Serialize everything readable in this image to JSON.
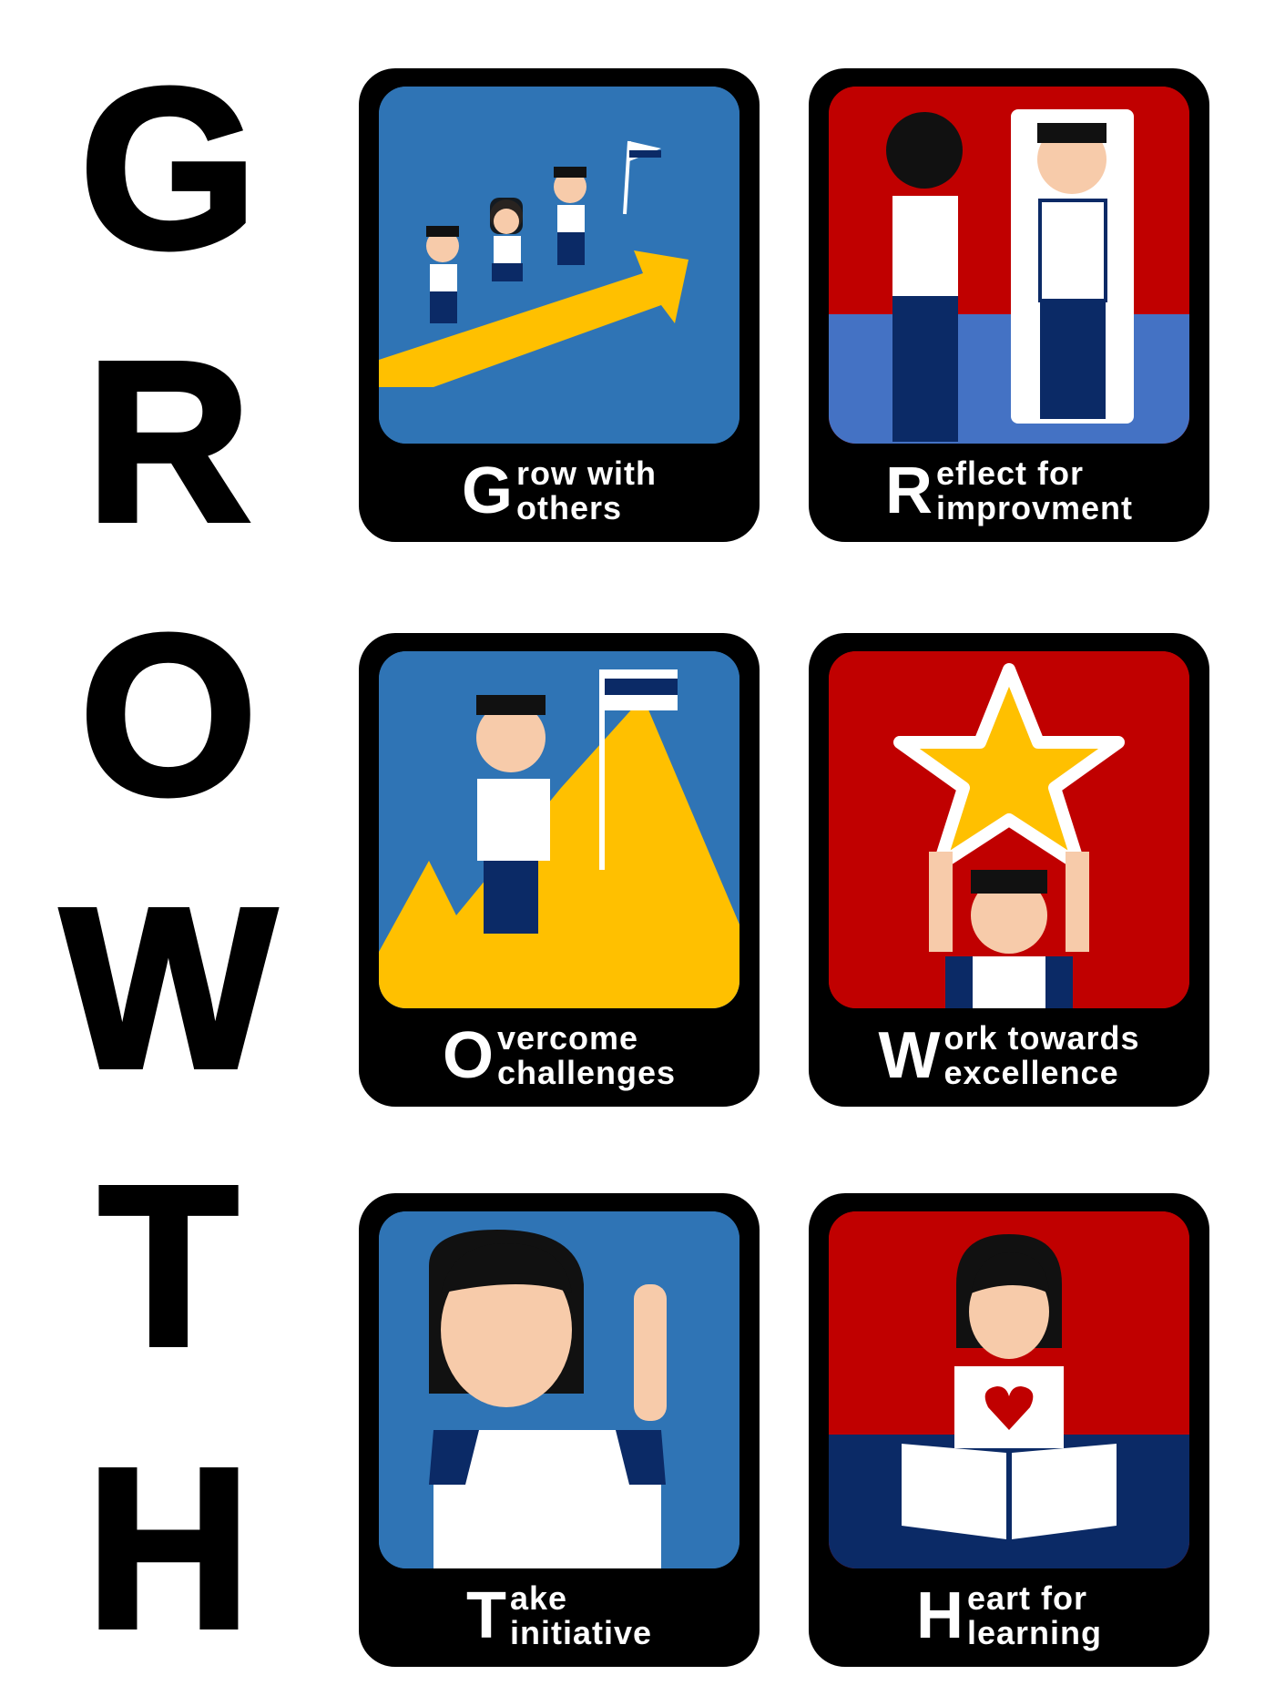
{
  "acronym": [
    "G",
    "R",
    "O",
    "W",
    "T",
    "H"
  ],
  "cards": [
    {
      "initial": "G",
      "line1": "row with",
      "line2": "others",
      "theme": "blue"
    },
    {
      "initial": "R",
      "line1": "eflect for",
      "line2": "improvment",
      "theme": "red"
    },
    {
      "initial": "O",
      "line1": "vercome",
      "line2": "challenges",
      "theme": "blue"
    },
    {
      "initial": "W",
      "line1": "ork towards",
      "line2": "excellence",
      "theme": "red"
    },
    {
      "initial": "T",
      "line1": "ake",
      "line2": "initiative",
      "theme": "blue"
    },
    {
      "initial": "H",
      "line1": "eart for",
      "line2": "learning",
      "theme": "red"
    }
  ],
  "colors": {
    "blue_panel": "#2f74b5",
    "red_panel": "#c00000",
    "navy": "#0b2a66",
    "yellow": "#ffc000",
    "skin": "#f7cbaa",
    "light_blue_floor": "#4472c4"
  }
}
